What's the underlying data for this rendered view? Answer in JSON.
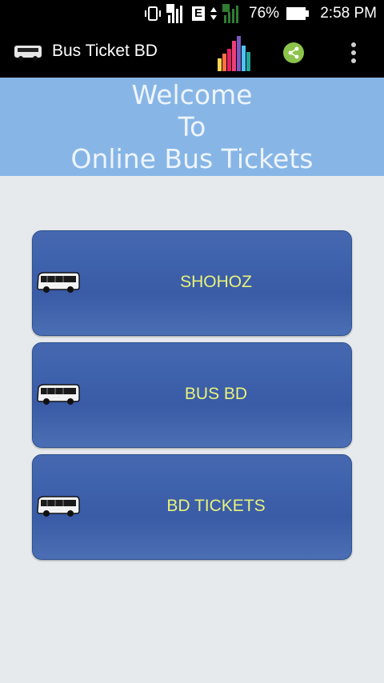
{
  "status_bar": {
    "battery_percent": "76%",
    "time": "2:58 PM",
    "network_label": "E"
  },
  "app_bar": {
    "title": "Bus Ticket BD",
    "icons": [
      "bus-icon",
      "chart-icon",
      "share-icon",
      "overflow-menu-icon"
    ]
  },
  "banner": {
    "line1": "Welcome",
    "line2": "To",
    "line3": "Online Bus Tickets"
  },
  "providers": [
    {
      "label": "SHOHOZ"
    },
    {
      "label": "BUS BD"
    },
    {
      "label": "BD TICKETS"
    }
  ],
  "colors": {
    "banner": "#87b6e6",
    "button": "#3f62ad",
    "button_text": "#e8f37a",
    "share": "#8bc34a"
  }
}
